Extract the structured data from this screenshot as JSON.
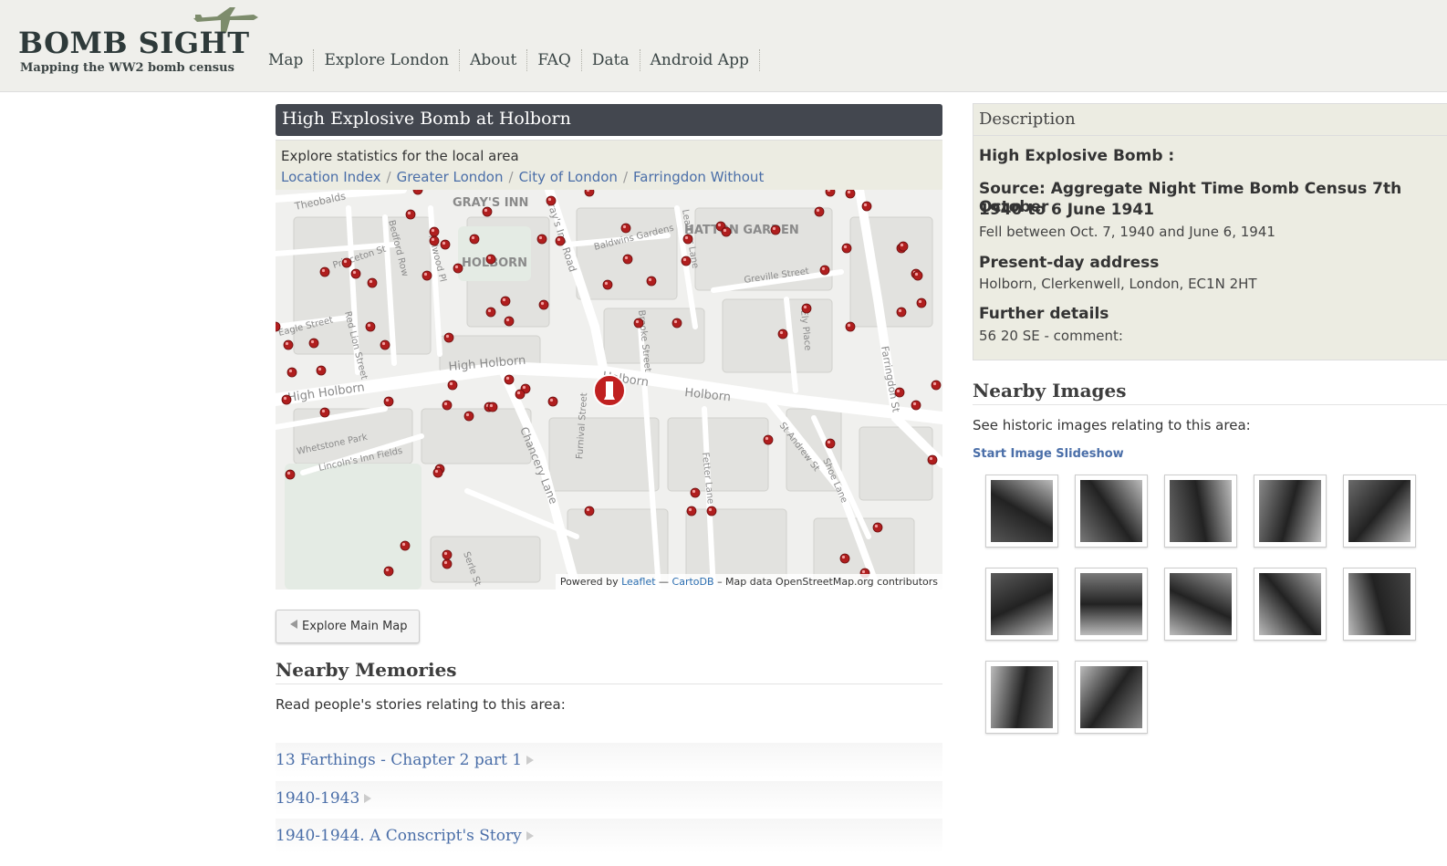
{
  "header": {
    "logo_title": "BOMB SIGHT",
    "logo_subtitle": "Mapping the WW2 bomb census",
    "nav": [
      "Map",
      "Explore London",
      "About",
      "FAQ",
      "Data",
      "Android App"
    ]
  },
  "main": {
    "title": "High Explosive Bomb at Holborn",
    "explore_lead": "Explore statistics for the local area",
    "breadcrumbs": [
      "Location Index",
      "Greater London",
      "City of London",
      "Farringdon Without"
    ],
    "map": {
      "labels": [
        "GRAY'S INN",
        "HOLBORN",
        "HATTON GARDEN",
        "High Holborn",
        "Holborn",
        "Holborn",
        "Chancery Lane",
        "Gray's Inn Road",
        "Farringdon St",
        "High Holborn",
        "Theobalds",
        "Lincoln's Inn Fields",
        "Whetstone Park",
        "Greville Street",
        "Baldwins Gardens",
        "Bedford Row",
        "Red Lion Street",
        "Princeton St",
        "Furnival Street",
        "Fetter Lane",
        "Brooke Street",
        "Ely Place",
        "Shoe Lane",
        "St Andrew St",
        "Eagle Street",
        "Leather Lane",
        "Fulwood Pl",
        "Serle St"
      ],
      "attribution_prefix": "Powered by",
      "attribution_leaflet": "Leaflet",
      "attribution_dash": "—",
      "attribution_carto": "CartoDB",
      "attribution_suffix": "– Map data OpenStreetMap.org contributors",
      "marker_color": "#b01e1e"
    },
    "explore_button": "Explore Main Map",
    "memories": {
      "heading": "Nearby Memories",
      "intro": "Read people's stories relating to this area:",
      "items": [
        "13 Farthings - Chapter 2 part 1",
        "1940-1943",
        "1940-1944. A Conscript's Story"
      ]
    }
  },
  "sidebar": {
    "description": {
      "heading": "Description",
      "bomb_type": "High Explosive Bomb :",
      "source_label": "Source: Aggregate Night Time Bomb Census 7th October 1940 to 6 June 1941",
      "source_line1": "Source: Aggregate Night Time Bomb Census 7th October",
      "source_line2": "1940 to 6 June 1941",
      "fell_between": "Fell between Oct. 7, 1940 and June 6, 1941",
      "address_label": "Present-day address",
      "address": "Holborn, Clerkenwell, London, EC1N 2HT",
      "details_label": "Further details",
      "details": "56 20 SE - comment:"
    },
    "images": {
      "heading": "Nearby Images",
      "intro": "See historic images relating to this area:",
      "slideshow": "Start Image Slideshow",
      "count": 12
    }
  }
}
